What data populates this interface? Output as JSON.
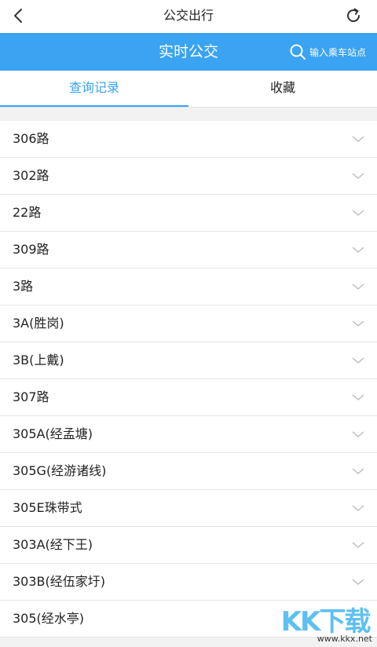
{
  "header": {
    "title": "公交出行",
    "back_icon": "chevron-left-icon",
    "refresh_icon": "refresh-icon"
  },
  "banner": {
    "title": "实时公交",
    "search_label": "输入乘车站点",
    "search_icon": "search-icon",
    "color": "#3aa3f2"
  },
  "tabs": [
    {
      "label": "查询记录",
      "active": true
    },
    {
      "label": "收藏",
      "active": false
    }
  ],
  "routes": [
    {
      "label": "306路"
    },
    {
      "label": "302路"
    },
    {
      "label": "22路"
    },
    {
      "label": "309路"
    },
    {
      "label": "3路"
    },
    {
      "label": "3A(胜岗)"
    },
    {
      "label": "3B(上戴)"
    },
    {
      "label": "307路"
    },
    {
      "label": "305A(经孟塘)"
    },
    {
      "label": "305G(经游诸线)"
    },
    {
      "label": "305E珠带式"
    },
    {
      "label": "303A(经下王)"
    },
    {
      "label": "303B(经伍家圩)"
    },
    {
      "label": "305(经水亭)"
    }
  ],
  "watermark": {
    "text": "KK下载",
    "url": "www.kkx.net"
  }
}
